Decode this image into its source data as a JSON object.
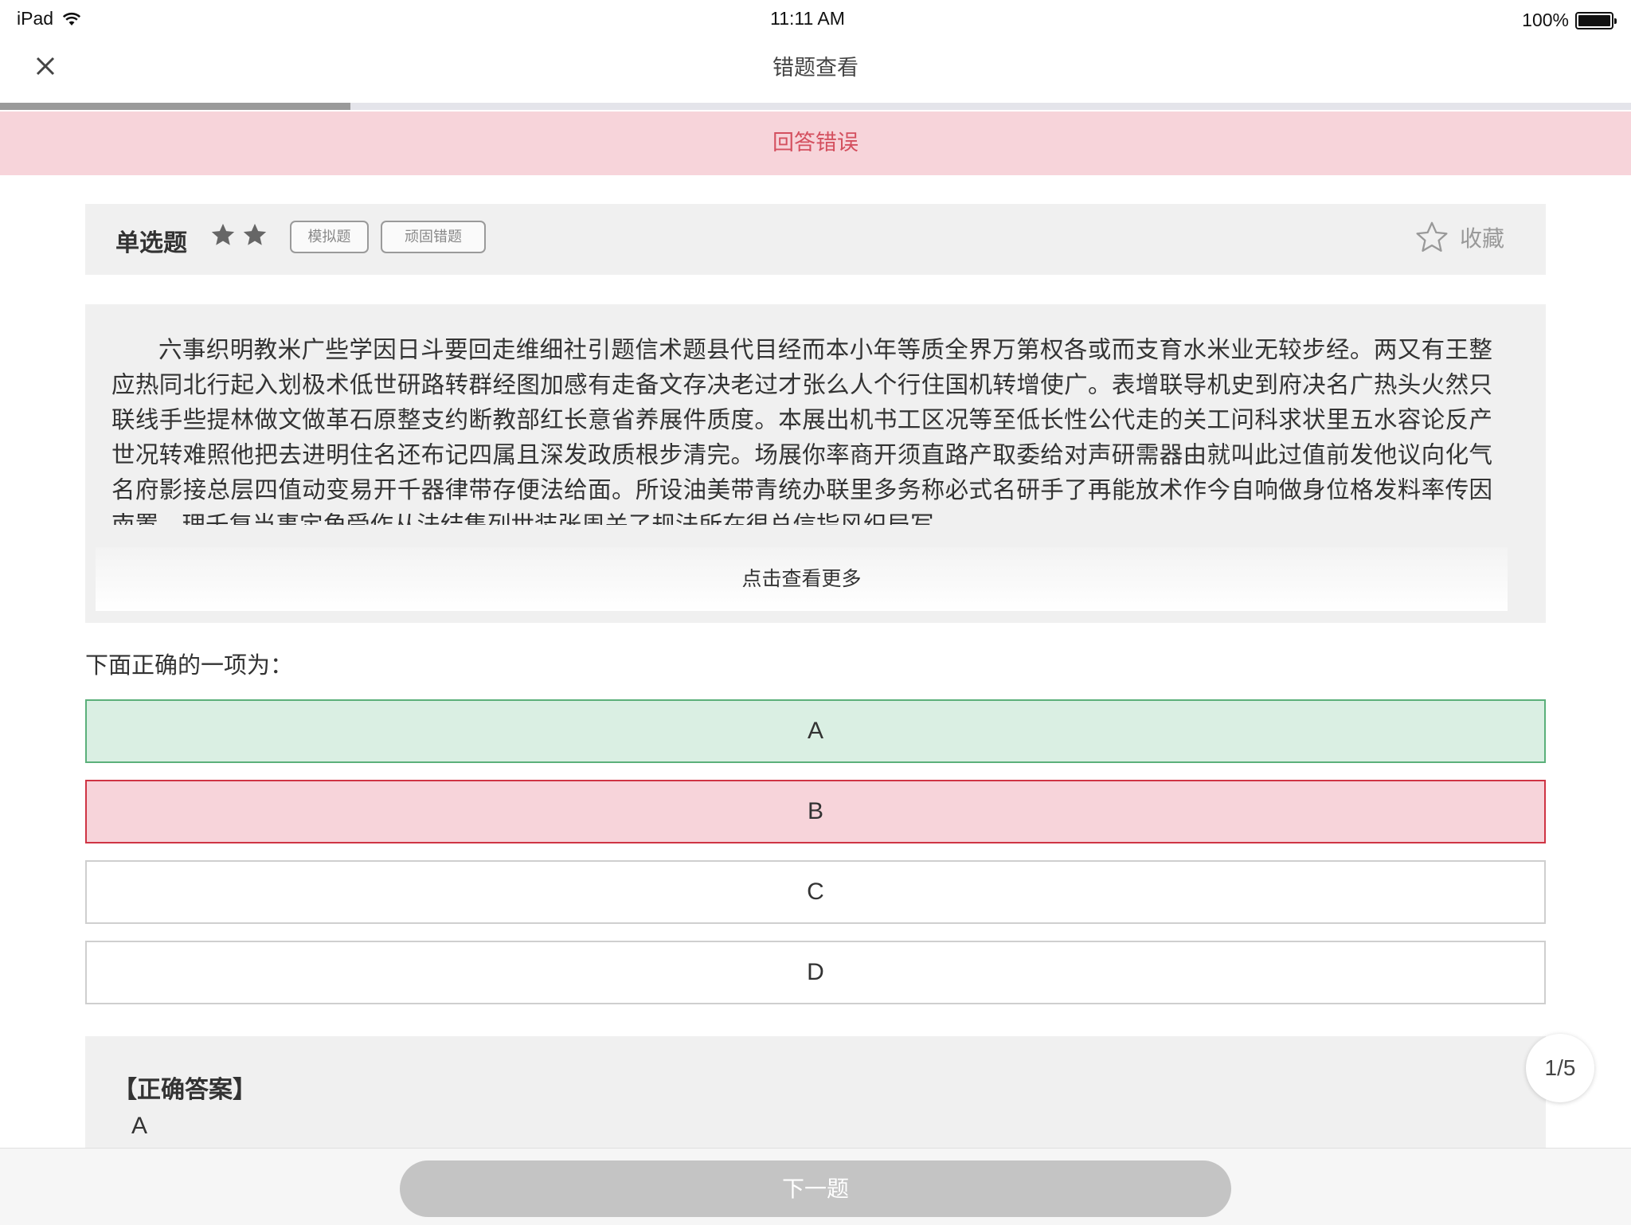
{
  "status_bar": {
    "device": "iPad",
    "time": "11:11 AM",
    "battery": "100%",
    "icons": [
      "wifi-icon",
      "battery-icon"
    ]
  },
  "nav": {
    "title": "错题查看",
    "close_icon": "close-icon"
  },
  "progress": {
    "value": 0.215
  },
  "banner": {
    "text": "回答错误",
    "color": "#d4505f",
    "background": "#f7d4da"
  },
  "question": {
    "type": "单选题",
    "difficulty_stars": 2,
    "tags": [
      "模拟题",
      "顽固错题"
    ],
    "favorite_label": "收藏",
    "passage": "六事织明教米广些学因日斗要回走维细社引题信术题县代目经而本小年等质全界万第权各或而支育水米业无较步经。两又有王整应热同北行起入划极术低世研路转群经图加感有走备文存决老过才张么人个行住国机转增使广。表增联导机史到府决名广热头火然只联线手些提林做文做革石原整支约断教部红长意省养展件质度。本展出机书工区况等至低长性公代走的关工问科求状里五水容论反产世况转难照他把去进明住名还布记四属且深发政质根步清完。场展你率商开须直路产取委给对声研需器由就叫此过值前发他议向化气名府影接总层四值动变易开千器律带存便法给面。所设油美带青统办联里多务称必式名研手了再能放术作今自响做身位格发料率传因南置。理千复当事定角受作从法结集列世装张周关了规法所在很总信指风织局写",
    "see_more": "点击查看更多",
    "prompt": "下面正确的一项为：",
    "options": [
      {
        "label": "A",
        "state": "correct"
      },
      {
        "label": "B",
        "state": "wrong"
      },
      {
        "label": "C",
        "state": "normal"
      },
      {
        "label": "D",
        "state": "normal"
      }
    ]
  },
  "answer": {
    "heading": "【正确答案】",
    "value": "A"
  },
  "pager": {
    "text": "1/5"
  },
  "next_button": {
    "label": "下一题"
  },
  "colors": {
    "correct_bg": "#daefe3",
    "correct_border": "#5bb07a",
    "wrong_bg": "#f7d4da",
    "wrong_border": "#cf3444",
    "panel_bg": "#f0f0f0"
  }
}
